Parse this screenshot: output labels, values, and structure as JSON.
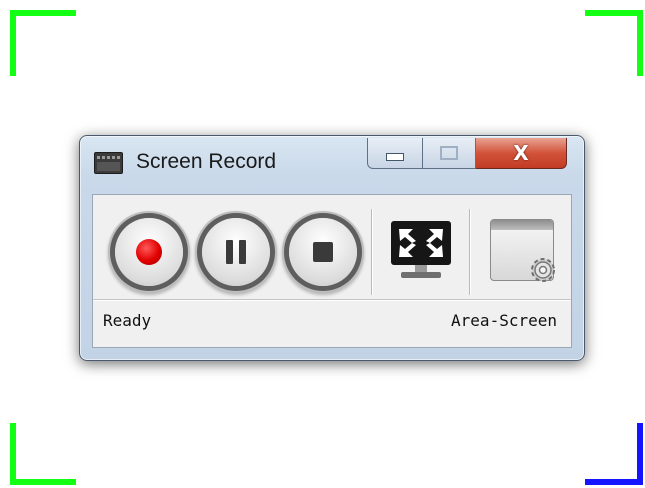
{
  "window": {
    "title": "Screen Record",
    "close_glyph": "X"
  },
  "toolbar": {
    "buttons": [
      {
        "name": "record",
        "icon": "record-icon"
      },
      {
        "name": "pause",
        "icon": "pause-icon"
      },
      {
        "name": "stop",
        "icon": "stop-icon"
      },
      {
        "name": "fullscreen",
        "icon": "fullscreen-monitor-icon"
      },
      {
        "name": "settings",
        "icon": "settings-gear-icon"
      }
    ]
  },
  "status": {
    "left": "Ready",
    "right": "Area-Screen"
  },
  "colors": {
    "corner_green": "#13ff13",
    "corner_blue": "#1414ff",
    "record_red": "#e00000",
    "close_red": "#c23c24"
  }
}
